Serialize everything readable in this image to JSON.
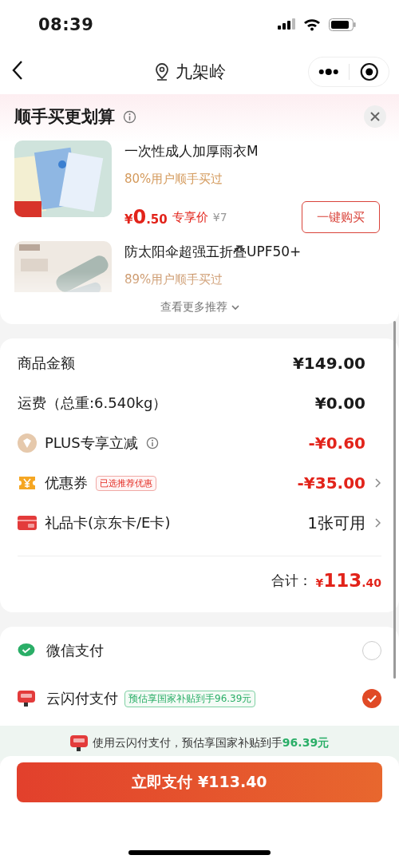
{
  "status_bar": {
    "time": "08:39"
  },
  "nav": {
    "location": "九架岭"
  },
  "recommend": {
    "title": "顺手买更划算",
    "items": [
      {
        "kind": "full",
        "name": "一次性成人加厚雨衣M",
        "social": "80%用户顺手买过",
        "currency": "¥",
        "price_int": "0",
        "price_dec": ".50",
        "price_label": "专享价",
        "original_price": "¥7",
        "button": "一键购买"
      },
      {
        "kind": "partial",
        "name": "防太阳伞超强五折叠UPF50+",
        "social": "89%用户顺手买过"
      }
    ],
    "more": "查看更多推荐"
  },
  "summary": {
    "rows": [
      {
        "kind": "plain",
        "label": "商品金额",
        "value": "¥149.00"
      },
      {
        "kind": "plain",
        "label": "运费（总重:6.540kg）",
        "value": "¥0.00"
      },
      {
        "kind": "plus",
        "label": "PLUS专享立减",
        "value": "-¥0.60"
      },
      {
        "kind": "coupon",
        "label": "优惠券",
        "tag": "已选推荐优惠",
        "value": "-¥35.00"
      },
      {
        "kind": "giftcard",
        "label": "礼品卡(京东卡/E卡)",
        "value": "1张可用"
      }
    ],
    "total_label": "合计：",
    "total_currency": "¥",
    "total_int": "113",
    "total_dec": ".40"
  },
  "payment": {
    "methods": [
      {
        "kind": "wechat",
        "name": "微信支付",
        "selected": false
      },
      {
        "kind": "unionpay",
        "name": "云闪付支付",
        "tag": "预估享国家补贴到手96.39元",
        "selected": true
      }
    ],
    "tip": "使用云闪付支付，预估享国家补贴到手**96.39元**"
  },
  "pay_button": "立即支付 ¥113.40"
}
